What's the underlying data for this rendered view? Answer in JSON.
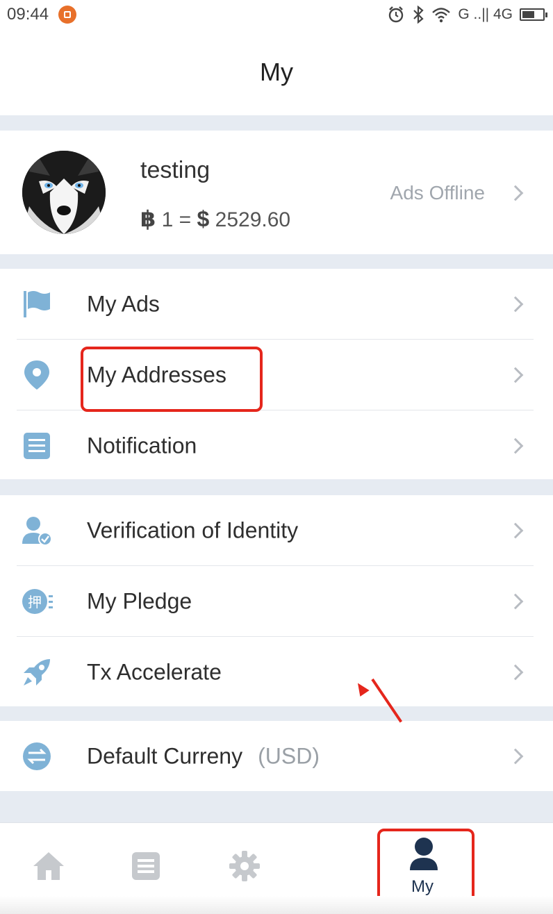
{
  "status_bar": {
    "time": "09:44",
    "network": "G ..|| 4G"
  },
  "header": {
    "title": "My"
  },
  "profile": {
    "username": "testing",
    "rate_left": "1 =",
    "rate_value": "2529.60",
    "btc_symbol": "฿",
    "usd_symbol": "$",
    "ads_status": "Ads Offline"
  },
  "menu": {
    "group1": [
      {
        "label": "My Ads",
        "icon": "flag-icon"
      },
      {
        "label": "My Addresses",
        "icon": "location-pin-icon"
      },
      {
        "label": "Notification",
        "icon": "document-icon"
      }
    ],
    "group2": [
      {
        "label": "Verification of Identity",
        "icon": "user-verified-icon"
      },
      {
        "label": "My Pledge",
        "icon": "pledge-icon"
      },
      {
        "label": "Tx Accelerate",
        "icon": "rocket-icon"
      }
    ],
    "group3": [
      {
        "label": "Default Curreny",
        "value": "(USD)",
        "icon": "exchange-icon"
      }
    ]
  },
  "pledge_glyph": "押",
  "tabbar": {
    "items": [
      {
        "icon": "home-icon",
        "label": ""
      },
      {
        "icon": "list-icon",
        "label": ""
      },
      {
        "icon": "gear-icon",
        "label": ""
      },
      {
        "icon": "user-icon",
        "label": "My",
        "active": true
      }
    ]
  },
  "colors": {
    "accent": "#1e3350",
    "icon": "#7fb2d6",
    "highlight": "#e5261c",
    "background": "#e6ebf2"
  }
}
